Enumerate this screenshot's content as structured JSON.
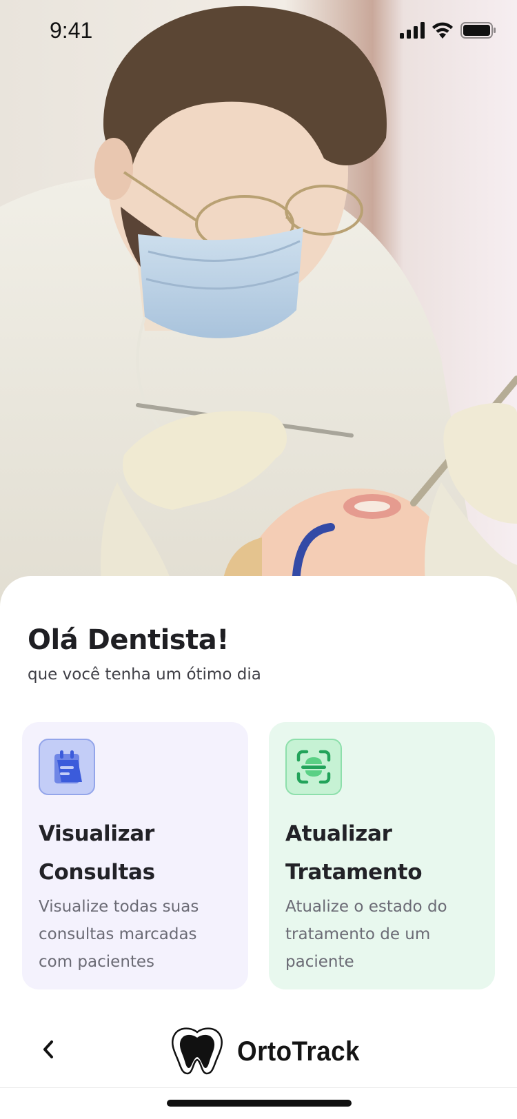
{
  "status_bar": {
    "time": "9:41"
  },
  "hero": {
    "image_subject": "dentist-treating-patient-photo"
  },
  "greeting": {
    "title": "Olá Dentista!",
    "subtitle": "que você tenha um ótimo dia"
  },
  "cards": [
    {
      "icon": "calendar-icon",
      "title_line1": "Visualizar",
      "title_line2": "Consultas",
      "description": "Visualize todas suas consultas marcadas com pacientes",
      "accent": "#3b5bdb",
      "background": "#f4f2fd"
    },
    {
      "icon": "scan-icon",
      "title_line1": "Atualizar",
      "title_line2": "Tratamento",
      "description": "Atualize o estado do tratamento de um paciente",
      "accent": "#22a35a",
      "background": "#e8f8ee"
    }
  ],
  "bottom_bar": {
    "back_icon": "chevron-left-icon",
    "logo_icon": "tooth-logo-icon",
    "brand_name": "OrtoTrack"
  }
}
